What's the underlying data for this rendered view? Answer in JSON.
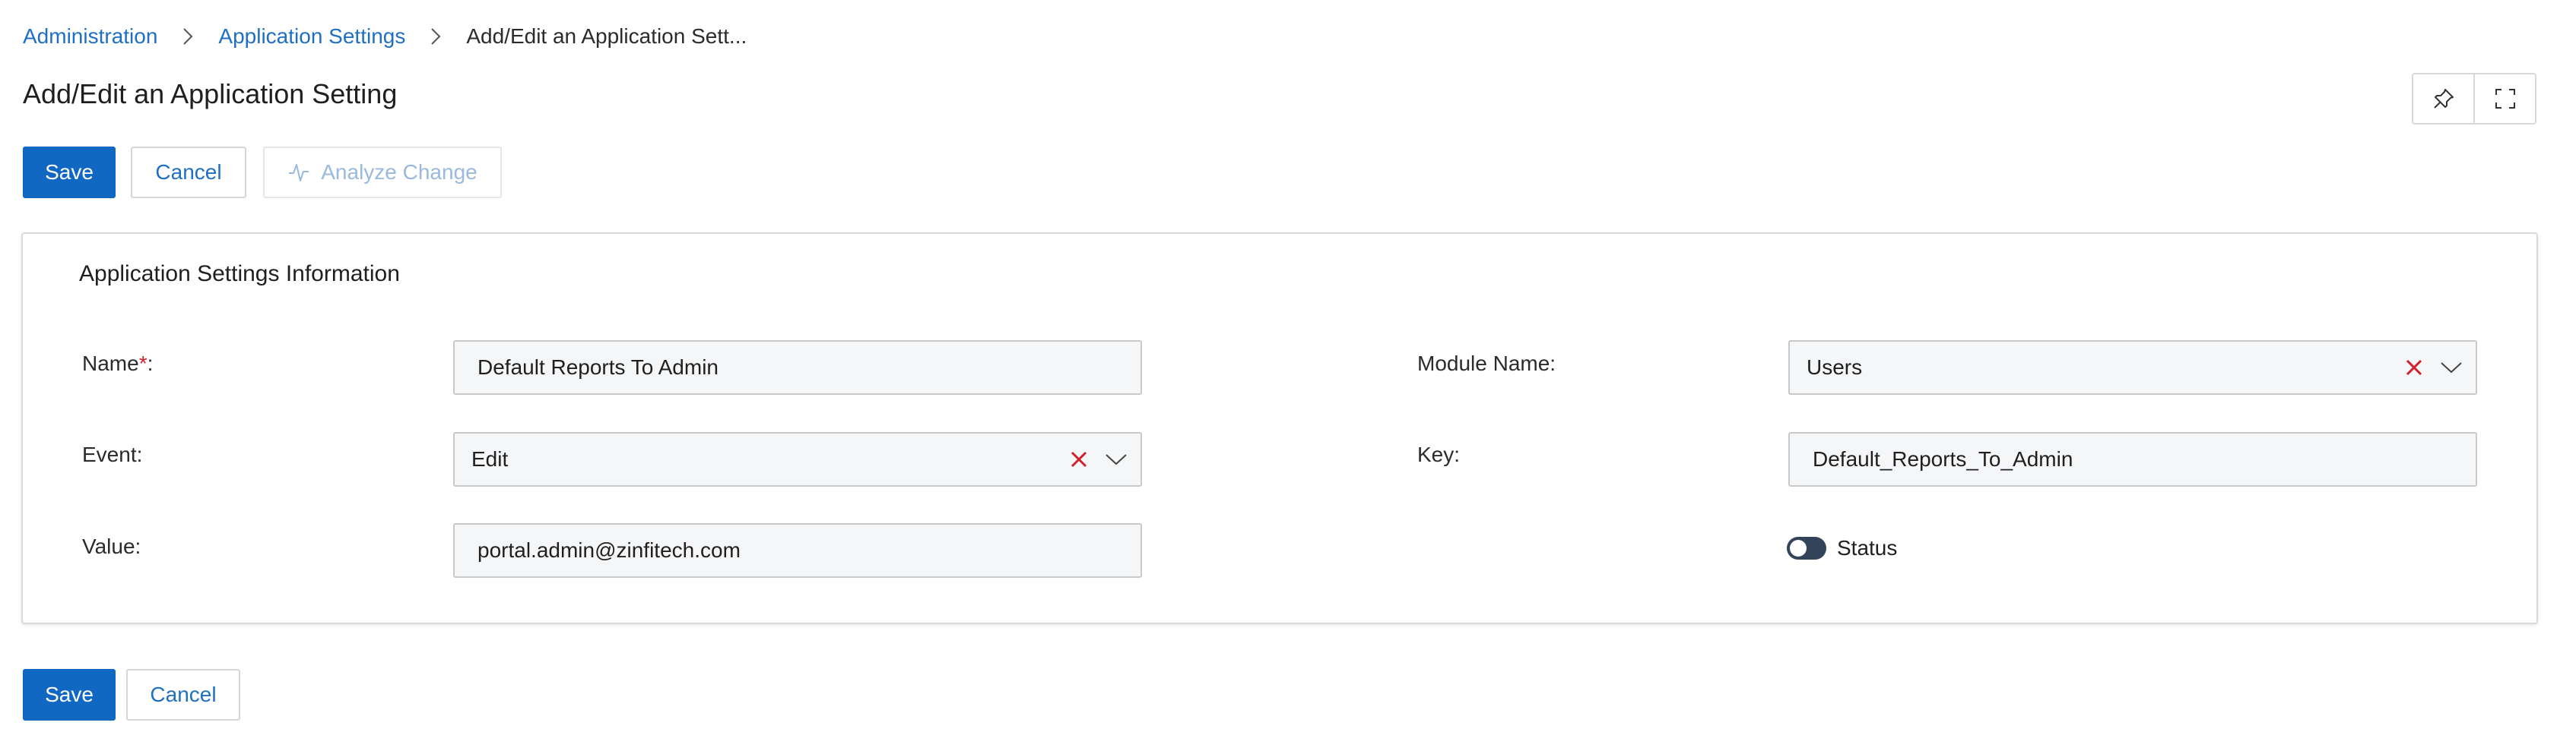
{
  "breadcrumb": {
    "items": [
      "Administration",
      "Application Settings"
    ],
    "current": "Add/Edit an Application Sett..."
  },
  "page": {
    "title": "Add/Edit an Application Setting"
  },
  "toolbar": {
    "save_label": "Save",
    "cancel_label": "Cancel",
    "analyze_label": "Analyze Change"
  },
  "header_icons": [
    "pin-icon",
    "fullscreen-icon"
  ],
  "form": {
    "section_title": "Application Settings Information",
    "name": {
      "label": "Name",
      "required_mark": "*",
      "suffix": ":",
      "value": "Default Reports To Admin"
    },
    "event": {
      "label": "Event:",
      "value": "Edit"
    },
    "value_field": {
      "label": "Value:",
      "value": "portal.admin@zinfitech.com"
    },
    "module": {
      "label": "Module Name:",
      "value": "Users"
    },
    "key": {
      "label": "Key:",
      "value": "Default_Reports_To_Admin"
    },
    "status": {
      "label": "Status",
      "enabled": false
    }
  },
  "footer": {
    "save_label": "Save",
    "cancel_label": "Cancel"
  },
  "colors": {
    "primary": "#1168c2",
    "link": "#1f6fc5",
    "clear_icon": "#d0202b",
    "toggle": "#33435a"
  }
}
